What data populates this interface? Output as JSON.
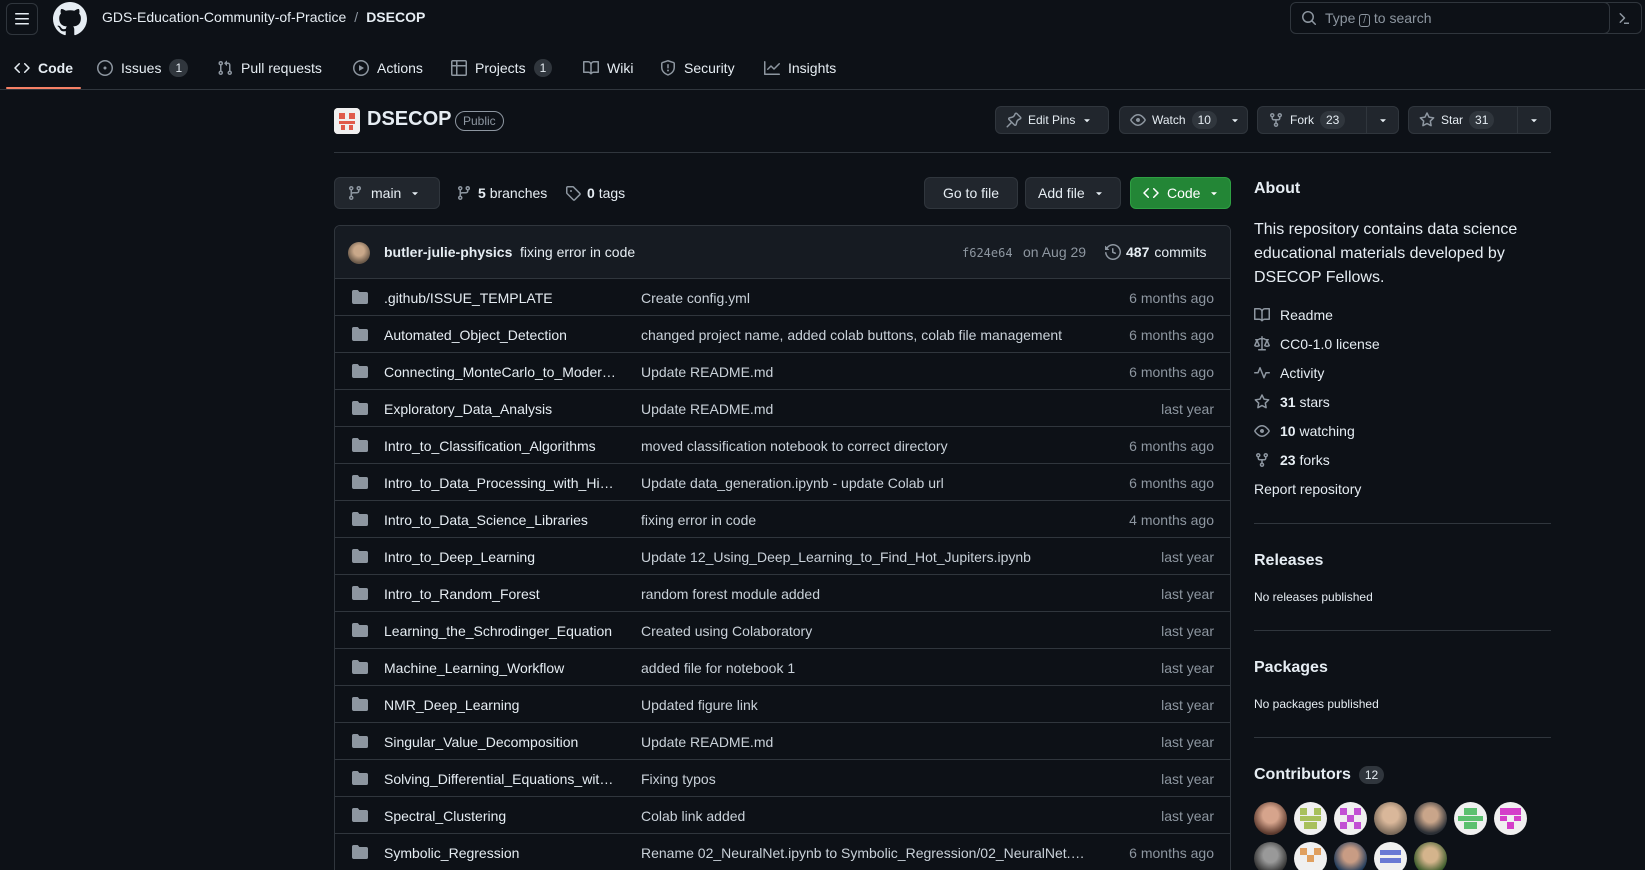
{
  "header": {
    "owner": "GDS-Education-Community-of-Practice",
    "separator": "/",
    "repo": "DSECOP",
    "search_prefix": "Type",
    "search_key": "/",
    "search_suffix": "to search"
  },
  "nav": {
    "tabs": [
      {
        "label": "Code",
        "count": null
      },
      {
        "label": "Issues",
        "count": "1"
      },
      {
        "label": "Pull requests",
        "count": null
      },
      {
        "label": "Actions",
        "count": null
      },
      {
        "label": "Projects",
        "count": "1"
      },
      {
        "label": "Wiki",
        "count": null
      },
      {
        "label": "Security",
        "count": null
      },
      {
        "label": "Insights",
        "count": null
      }
    ]
  },
  "repo": {
    "name": "DSECOP",
    "visibility": "Public",
    "edit_pins": "Edit Pins",
    "watch_label": "Watch",
    "watch_count": "10",
    "fork_label": "Fork",
    "fork_count": "23",
    "star_label": "Star",
    "star_count": "31"
  },
  "branch_bar": {
    "branch": "main",
    "branches_count": "5",
    "branches_label": "branches",
    "tags_count": "0",
    "tags_label": "tags",
    "go_to_file": "Go to file",
    "add_file": "Add file",
    "code": "Code"
  },
  "latest_commit": {
    "author": "butler-julie-physics",
    "message": "fixing error in code",
    "sha": "f624e64",
    "date": "on Aug 29",
    "count": "487",
    "count_label": "commits"
  },
  "files": [
    {
      "name": ".github/ISSUE_TEMPLATE",
      "message": "Create config.yml",
      "date": "6 months ago"
    },
    {
      "name": "Automated_Object_Detection",
      "message": "changed project name, added colab buttons, colab file management",
      "date": "6 months ago"
    },
    {
      "name": "Connecting_MonteCarlo_to_Moder…",
      "message": "Update README.md",
      "date": "6 months ago"
    },
    {
      "name": "Exploratory_Data_Analysis",
      "message": "Update README.md",
      "date": "last year"
    },
    {
      "name": "Intro_to_Classification_Algorithms",
      "message": "moved classification notebook to correct directory",
      "date": "6 months ago"
    },
    {
      "name": "Intro_to_Data_Processing_with_Hi…",
      "message": "Update data_generation.ipynb - update Colab url",
      "date": "6 months ago"
    },
    {
      "name": "Intro_to_Data_Science_Libraries",
      "message": "fixing error in code",
      "date": "4 months ago"
    },
    {
      "name": "Intro_to_Deep_Learning",
      "message": "Update 12_Using_Deep_Learning_to_Find_Hot_Jupiters.ipynb",
      "date": "last year"
    },
    {
      "name": "Intro_to_Random_Forest",
      "message": "random forest module added",
      "date": "last year"
    },
    {
      "name": "Learning_the_Schrodinger_Equation",
      "message": "Created using Colaboratory",
      "date": "last year"
    },
    {
      "name": "Machine_Learning_Workflow",
      "message": "added file for notebook 1",
      "date": "last year"
    },
    {
      "name": "NMR_Deep_Learning",
      "message": "Updated figure link",
      "date": "last year"
    },
    {
      "name": "Singular_Value_Decomposition",
      "message": "Update README.md",
      "date": "last year"
    },
    {
      "name": "Solving_Differential_Equations_wit…",
      "message": "Fixing typos",
      "date": "last year"
    },
    {
      "name": "Spectral_Clustering",
      "message": "Colab link added",
      "date": "last year"
    },
    {
      "name": "Symbolic_Regression",
      "message": "Rename 02_NeuralNet.ipynb to Symbolic_Regression/02_NeuralNet.…",
      "date": "6 months ago"
    }
  ],
  "about": {
    "heading": "About",
    "description": "This repository contains data science educational materials developed by DSECOP Fellows.",
    "readme": "Readme",
    "license": "CC0-1.0 license",
    "activity": "Activity",
    "stars_count": "31",
    "stars_label": "stars",
    "watching_count": "10",
    "watching_label": "watching",
    "forks_count": "23",
    "forks_label": "forks",
    "report": "Report repository"
  },
  "releases": {
    "heading": "Releases",
    "note": "No releases published"
  },
  "packages": {
    "heading": "Packages",
    "note": "No packages published"
  },
  "contributors": {
    "heading": "Contributors",
    "count": "12"
  },
  "colors": {
    "accent_tab": "#f78166",
    "green_button": "#238636",
    "background": "#0d1117"
  }
}
